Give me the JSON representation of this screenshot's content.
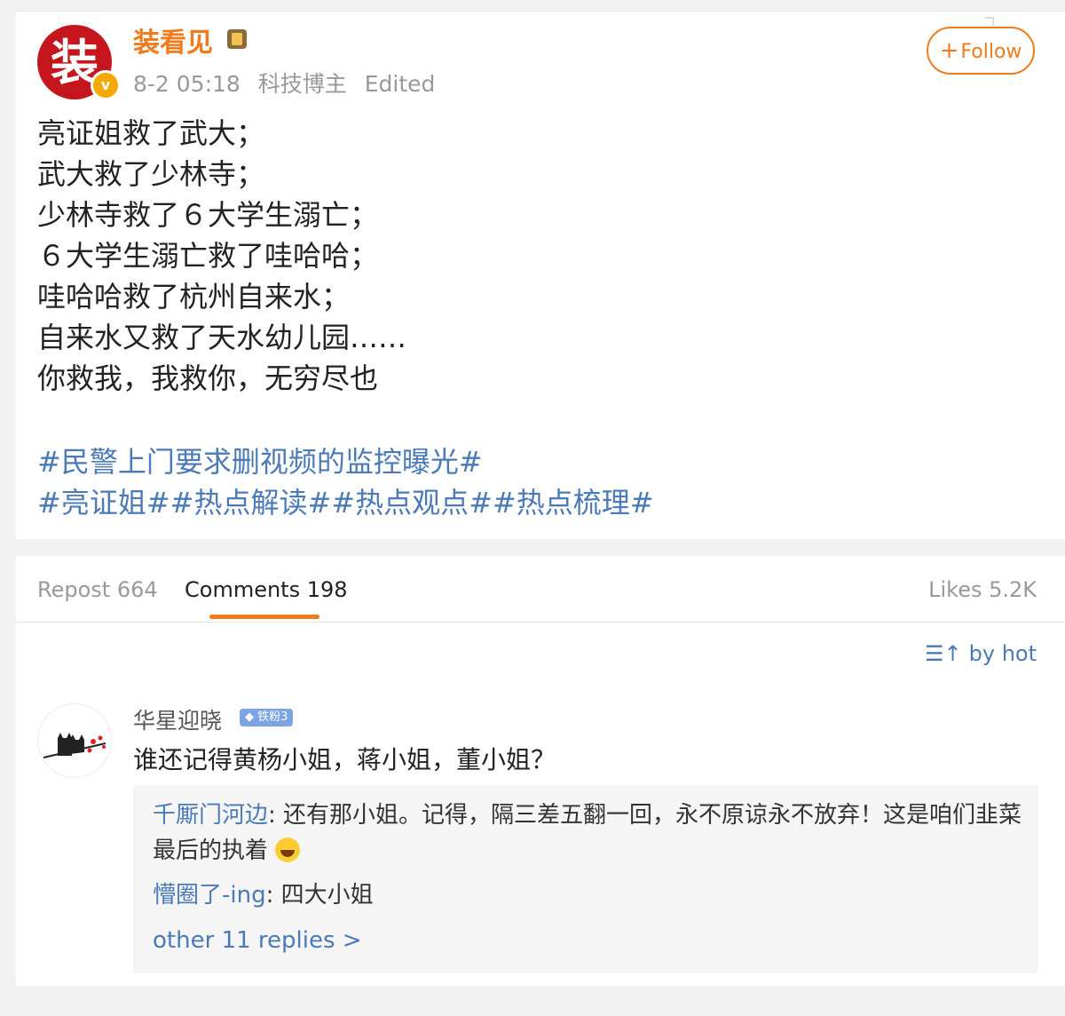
{
  "post": {
    "avatar_char": "装",
    "username": "装看见",
    "time": "8-2 05:18",
    "source": "科技博主",
    "edited": "Edited",
    "follow_label": "Follow",
    "body_lines": [
      "亮证姐救了武大；",
      "武大救了少林寺；",
      "少林寺救了６大学生溺亡；",
      "６大学生溺亡救了哇哈哈；",
      "哇哈哈救了杭州自来水；",
      "自来水又救了天水幼儿园……",
      "你救我，我救你，无穷尽也"
    ],
    "hashtag_lines": [
      "#民警上门要求删视频的监控曝光#",
      "#亮证姐##热点解读##热点观点##热点梳理#"
    ]
  },
  "tabs": {
    "repost": "Repost 664",
    "comments": "Comments 198",
    "likes": "Likes 5.2K"
  },
  "sort": {
    "label": "by hot",
    "icon": "sort-icon"
  },
  "comment": {
    "user": "华星迎晓",
    "fan_badge": "铁粉3",
    "text": "谁还记得黄杨小姐，蒋小姐，董小姐？",
    "replies": [
      {
        "author": "千厮门河边",
        "text": ": 还有那小姐。记得，隔三差五翻一回，永不原谅永不放弃！这是咱们韭菜最后的执着"
      },
      {
        "author": "懵圈了-ing",
        "text": ": 四大小姐"
      }
    ],
    "more_replies": "other 11 replies >"
  },
  "colors": {
    "accent": "#f07b1d",
    "link": "#4a7ab8",
    "avatar_red": "#c4161c",
    "verified": "#f5a800"
  }
}
